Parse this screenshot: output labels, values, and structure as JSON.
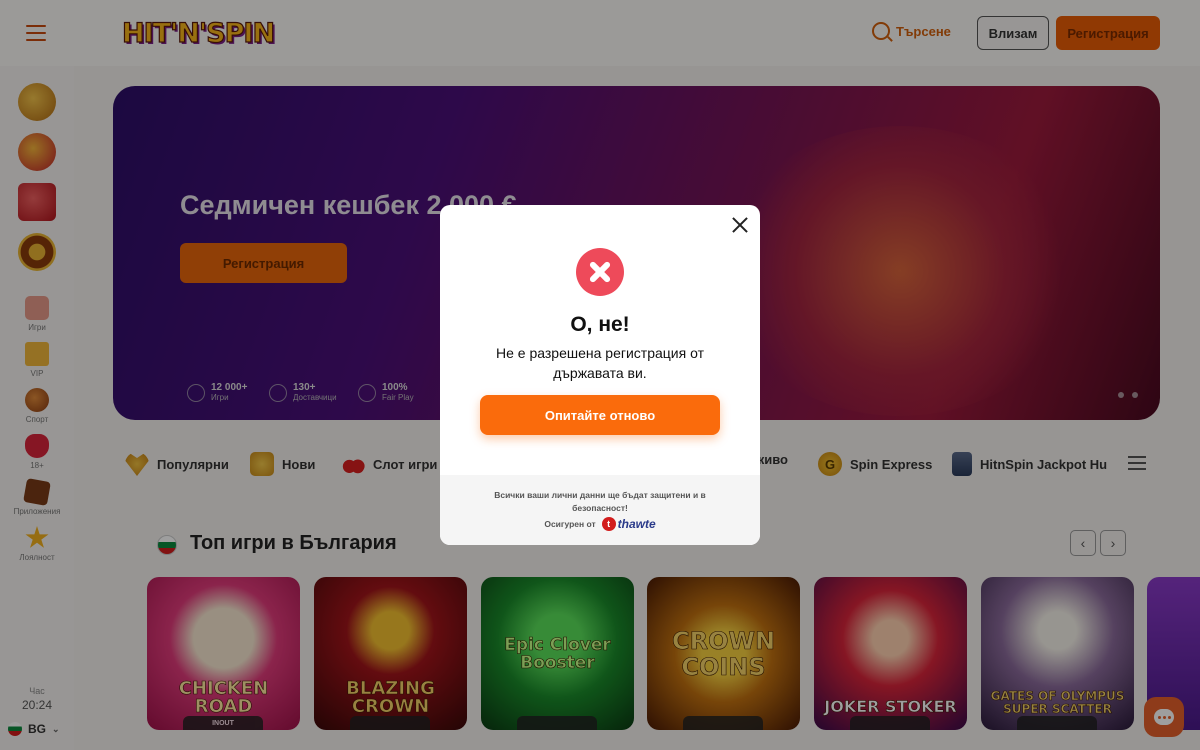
{
  "header": {
    "logo_text": "HIT'N'SPIN",
    "search_label": "Търсене",
    "login_label": "Влизам",
    "register_label": "Регистрация"
  },
  "sidebar": {
    "promos": [
      "sword-icon",
      "medal-icon",
      "gift-icon",
      "wheel-icon"
    ],
    "items": [
      {
        "label": "Игри",
        "icon": "dice-icon"
      },
      {
        "label": "VIP",
        "icon": "crown-icon"
      },
      {
        "label": "Спорт",
        "icon": "ball-icon"
      },
      {
        "label": "18+",
        "icon": "lips-icon"
      },
      {
        "label": "Приложения",
        "icon": "phone-icon"
      },
      {
        "label": "Лоялност",
        "icon": "star-icon"
      }
    ],
    "time_label": "Час",
    "time_value": "20:24",
    "language": "BG"
  },
  "hero": {
    "title": "Седмичен кешбек 2 000 €",
    "button_label": "Регистрация",
    "stats": [
      {
        "value": "12 000+",
        "label": "Игри"
      },
      {
        "value": "130+",
        "label": "Доставчици"
      },
      {
        "value": "100%",
        "label": "Fair Play"
      }
    ]
  },
  "categories": [
    {
      "label": "Популярни",
      "icon": "heart-icon"
    },
    {
      "label": "Нови",
      "icon": "hands-icon"
    },
    {
      "label": "Слот игри",
      "icon": "cherry-icon"
    },
    {
      "label": "живо",
      "icon": "live-icon"
    },
    {
      "label": "Spin Express",
      "icon": "g-coin-icon"
    },
    {
      "label": "HitnSpin Jackpot Hu",
      "icon": "jackpot-icon"
    }
  ],
  "section": {
    "title": "Топ игри в България",
    "prev": "‹",
    "next": "›"
  },
  "games": [
    {
      "title": "CHICKEN ROAD",
      "tag": "INOUT"
    },
    {
      "title": "BLAZING CROWN",
      "tag": ""
    },
    {
      "title": "Epic Clover Booster",
      "tag": ""
    },
    {
      "title": "CROWN COINS",
      "tag": ""
    },
    {
      "title": "JOKER STOKER",
      "tag": ""
    },
    {
      "title": "GATES OF OLYMPUS SUPER SCATTER",
      "tag": ""
    }
  ],
  "modal": {
    "title": "О, не!",
    "message": "Не е разрешена регистрация от държавата ви.",
    "retry_label": "Опитайте отново",
    "footer_text": "Всички ваши лични данни ще бъдат защитени и в безопасност!",
    "secured_by": "Осигурен от",
    "security_brand": "thawte"
  },
  "colors": {
    "accent": "#fa6b0c",
    "error": "#ee4a5a"
  }
}
